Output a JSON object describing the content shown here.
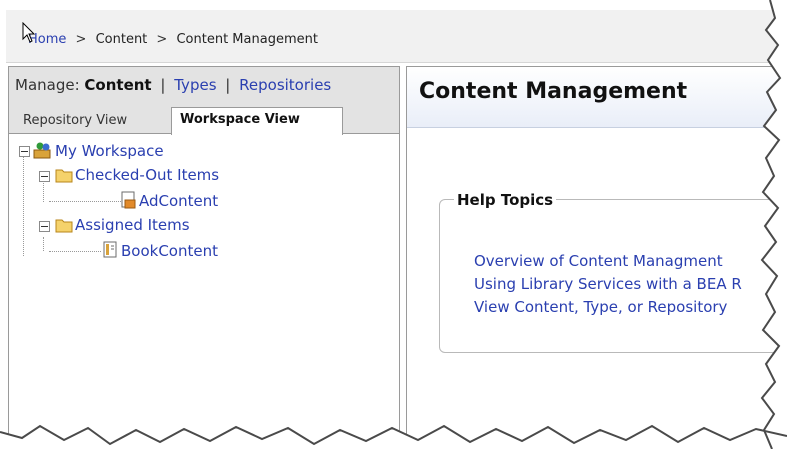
{
  "breadcrumb": {
    "home": "Home",
    "separator": ">",
    "content": "Content",
    "content_management": "Content Management"
  },
  "left_panel": {
    "manage_label": "Manage:",
    "manage_current": "Content",
    "separator": "|",
    "types_link": "Types",
    "repositories_link": "Repositories",
    "tabs": [
      {
        "label": "Repository View",
        "active": false
      },
      {
        "label": "Workspace View",
        "active": true
      }
    ],
    "tree": {
      "root": "My Workspace",
      "checked_out": "Checked-Out Items",
      "checked_out_children": [
        "AdContent"
      ],
      "assigned": "Assigned Items",
      "assigned_children": [
        "BookContent"
      ]
    }
  },
  "right_panel": {
    "title": "Content Management",
    "help_topics_title": "Help Topics",
    "help_links": [
      "Overview of Content Managment",
      "Using Library Services with a BEA R",
      "View Content, Type, or Repository"
    ]
  },
  "colors": {
    "link": "#2a3fb0",
    "panel_header": "#e3e3e3",
    "border": "#9a9a9a"
  }
}
